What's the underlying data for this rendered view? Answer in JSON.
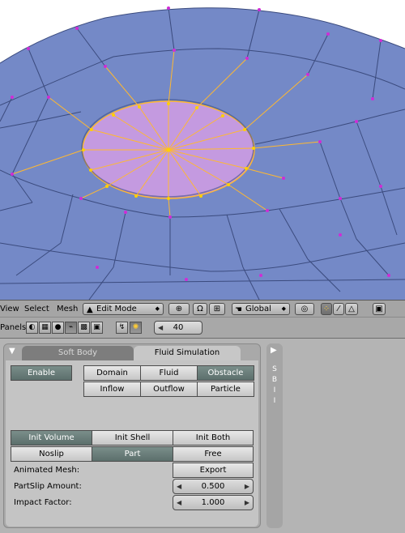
{
  "view_header": {
    "menus": [
      "View",
      "Select",
      "Mesh"
    ],
    "mode_selector": "Edit Mode",
    "orientation": "Global"
  },
  "buttons_header": {
    "panels_label": "Panels",
    "page_number": "40"
  },
  "panel": {
    "tabs": [
      "Soft Body",
      "Fluid Simulation"
    ],
    "enable_label": "Enable",
    "types_row1": [
      "Domain",
      "Fluid",
      "Obstacle"
    ],
    "types_row2": [
      "Inflow",
      "Outflow",
      "Particle"
    ],
    "init_row": [
      "Init Volume",
      "Init Shell",
      "Init Both"
    ],
    "slip_row": [
      "Noslip",
      "Part",
      "Free"
    ],
    "animated_mesh_label": "Animated Mesh:",
    "export_label": "Export",
    "partslip_label": "PartSlip Amount:",
    "partslip_value": "0.500",
    "impact_label": "Impact Factor:",
    "impact_value": "1.000"
  },
  "side_panel_letters": "S B I I",
  "colors": {
    "viewport_bg": "#7489c7",
    "selected_face": "#c49ae0",
    "selected_edge": "#ffb830",
    "vertex": "#d02cd6",
    "button_on": "#5c6f6c"
  }
}
